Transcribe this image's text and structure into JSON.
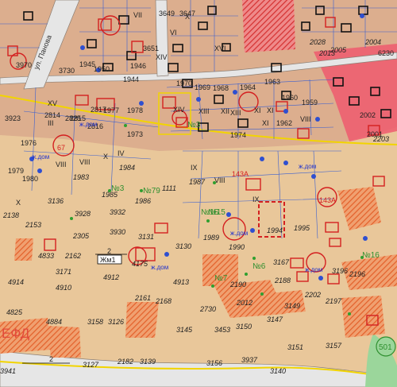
{
  "map": {
    "street_name": "ул. Панова",
    "parcel_labels": [
      "3649",
      "3647",
      "1945",
      "1950",
      "1946",
      "3651",
      "1944",
      "3730",
      "1970",
      "3970",
      "1969",
      "1964",
      "1963",
      "1968",
      "1960",
      "1962",
      "1959",
      "1974",
      "2002",
      "2001",
      "1977",
      "1978",
      "1973",
      "1976",
      "3923",
      "1979",
      "1980",
      "2815",
      "2817",
      "2814",
      "2816",
      "2825",
      "1983",
      "1984",
      "1985",
      "1986",
      "1111",
      "1987",
      "1989",
      "1990",
      "1994",
      "1995",
      "2138",
      "2153",
      "2305",
      "3930",
      "3928",
      "3932",
      "3131",
      "3130",
      "3171",
      "4914",
      "4910",
      "4912",
      "4913",
      "4884",
      "4825",
      "4175",
      "4833",
      "2162",
      "2161",
      "2168",
      "3167",
      "2188",
      "2190",
      "2730",
      "3147",
      "3145",
      "3453",
      "3150",
      "3151",
      "3157",
      "3158",
      "3126",
      "3127",
      "2182",
      "3139",
      "3140",
      "3941",
      "3937",
      "3156",
      "3149",
      "3196",
      "2196",
      "2197",
      "2202",
      "2203",
      "2004",
      "2005",
      "2013",
      "2028",
      "2012",
      "3136",
      "3902",
      "3139"
    ],
    "roman_labels": [
      "VII",
      "VI",
      "X",
      "XI",
      "XII",
      "XIII",
      "XIV",
      "XV",
      "III",
      "IV",
      "VIII",
      "IX",
      "VIII",
      "XI",
      "XIII",
      "XIV",
      "XVI",
      "XI",
      "X",
      "VIII",
      "IX",
      "VIII",
      "X"
    ],
    "red_labels": [
      "67",
      "143А",
      "143А"
    ],
    "blue_labels": [
      "ж.дом",
      "ж.дом",
      "ж.дом",
      "ж.дом",
      "ж.дом",
      "ж.дом"
    ],
    "green_labels": [
      "№79",
      "№3",
      "№15",
      "№16",
      "№6",
      "№7",
      "№1Б",
      "№3"
    ],
    "zone_label": "Жм1",
    "callout_number": "2",
    "bottom_number": "2",
    "district_label": "ЕФД",
    "corner_label": "501",
    "top_right_label": "6230"
  },
  "colors": {
    "base": "#e9c79a",
    "road": "#e8e8e8",
    "road_edge": "#9a8a7a",
    "block": "#d9a98a",
    "parcel_line": "#3a5fd0",
    "red_outline": "#d42020",
    "hatch": "#e3602a",
    "pink_zone": "#e84a5f",
    "yellow_line": "#f2d400",
    "green_area": "#8fd18f"
  }
}
